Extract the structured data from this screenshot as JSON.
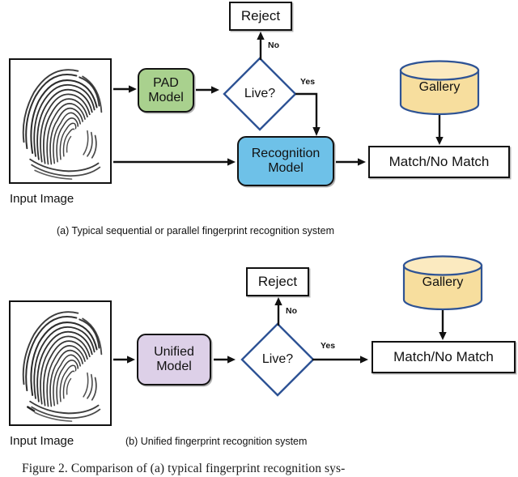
{
  "figure": {
    "caption": "Figure 2.  Comparison of (a) typical fingerprint recognition sys-"
  },
  "colors": {
    "pad_model_fill": "#A9D18E",
    "recognition_model_fill": "#6EC1E8",
    "unified_model_fill": "#DDD0E8",
    "gallery_fill": "#F7DE9E",
    "gallery_stroke": "#2E5395",
    "diamond_stroke": "#2E5395",
    "box_stroke": "#111111",
    "arrow_color": "#111111"
  },
  "panel_a": {
    "sub_caption": "(a) Typical sequential or parallel fingerprint recognition system",
    "input_label": "Input Image",
    "input_alt": "fingerprint-image",
    "pad_model": {
      "line1": "PAD",
      "line2": "Model"
    },
    "decision": {
      "label": "Live?"
    },
    "reject": {
      "label": "Reject"
    },
    "recognition_model": {
      "line1": "Recognition",
      "line2": "Model"
    },
    "gallery": {
      "label": "Gallery"
    },
    "result": {
      "label": "Match/No Match"
    },
    "edges": {
      "no": "No",
      "yes": "Yes"
    }
  },
  "panel_b": {
    "sub_caption": "(b) Unified fingerprint recognition system",
    "input_label": "Input Image",
    "input_alt": "fingerprint-image",
    "unified_model": {
      "line1": "Unified",
      "line2": "Model"
    },
    "decision": {
      "label": "Live?"
    },
    "reject": {
      "label": "Reject"
    },
    "gallery": {
      "label": "Gallery"
    },
    "result": {
      "label": "Match/No Match"
    },
    "edges": {
      "no": "No",
      "yes": "Yes"
    }
  }
}
